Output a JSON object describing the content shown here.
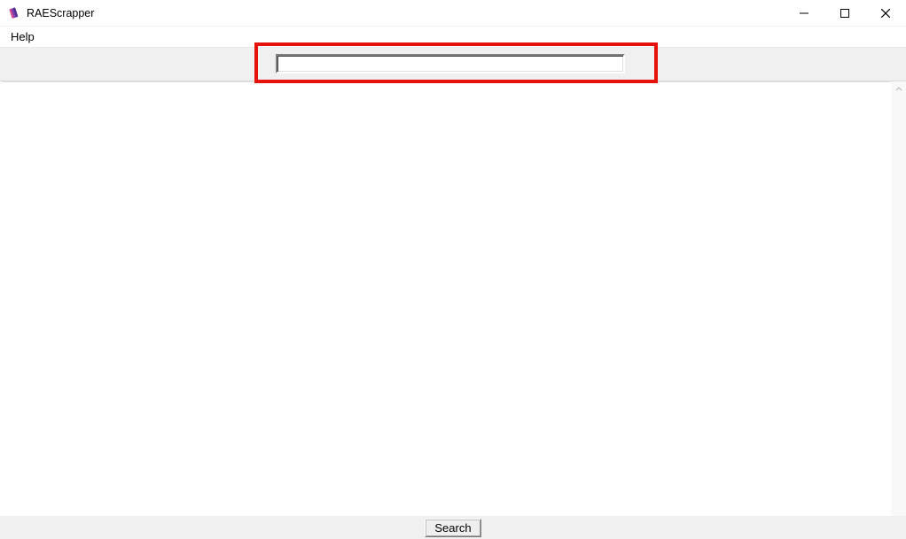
{
  "window": {
    "title": "RAEScrapper"
  },
  "menubar": {
    "items": [
      {
        "label": "Help"
      }
    ]
  },
  "toolbar": {
    "search_value": "",
    "search_placeholder": ""
  },
  "bottom": {
    "search_button_label": "Search"
  }
}
